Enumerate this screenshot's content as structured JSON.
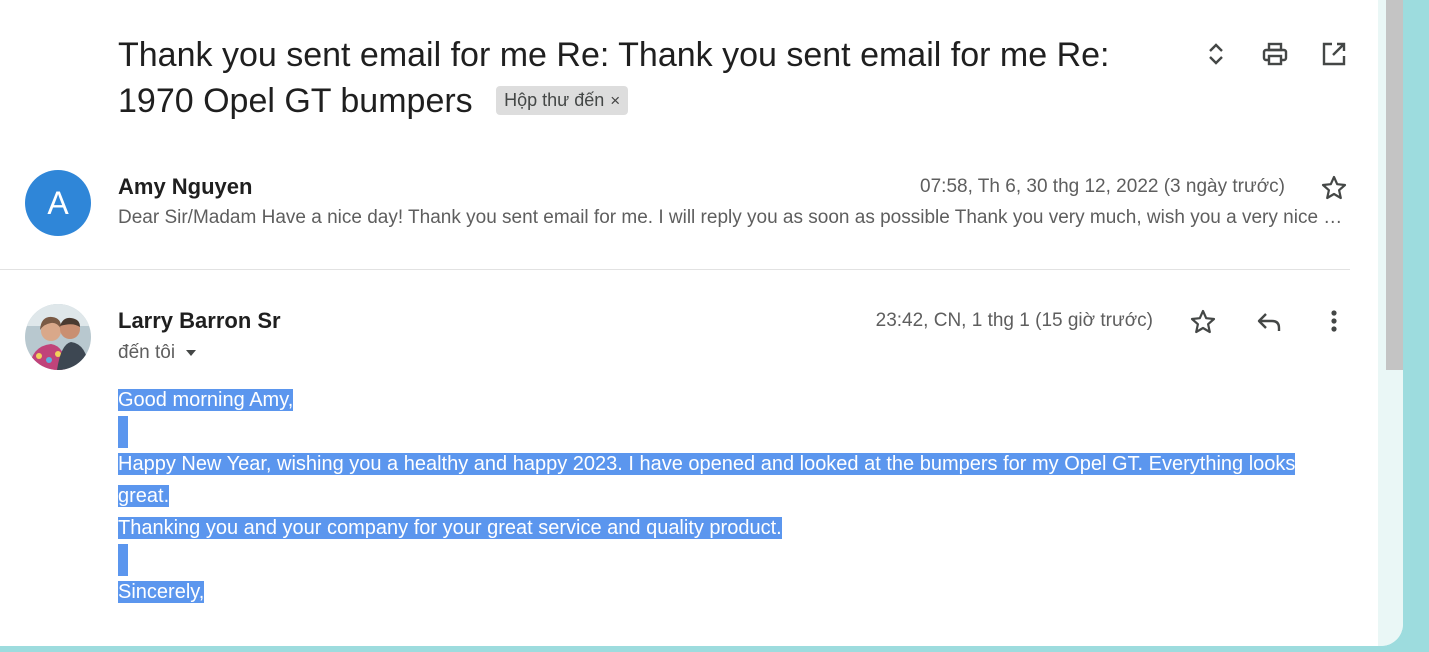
{
  "thread": {
    "subject": "Thank you sent email for me Re: Thank you sent email for me Re: 1970 Opel GT bumpers",
    "label": "Hộp thư đến",
    "label_remove": "×"
  },
  "toolbar_icons": [
    "expand-collapse-icon",
    "print-icon",
    "open-new-window-icon"
  ],
  "messages": [
    {
      "avatar_letter": "A",
      "avatar_color": "#2f86d8",
      "sender": "Amy Nguyen",
      "date": "07:58, Th 6, 30 thg 12, 2022 (3 ngày trước)",
      "snippet": "Dear Sir/Madam Have a nice day! Thank you sent email for me. I will reply you as soon as possible Thank you very much, wish you a very nice day!"
    },
    {
      "sender": "Larry Barron Sr",
      "date": "23:42, CN, 1 thg 1 (15 giờ trước)",
      "recipient": "đến tôi",
      "body": [
        "Good morning Amy,",
        "",
        "Happy New Year, wishing you a healthy and happy 2023. I have opened and looked at the bumpers for my Opel GT. Everything looks great.",
        "Thanking you and your company for your great service and quality product.",
        "",
        "Sincerely,"
      ]
    }
  ],
  "colors": {
    "background": "#9ddcde",
    "selection": "#5b96ee",
    "avatar": "#2f86d8"
  }
}
